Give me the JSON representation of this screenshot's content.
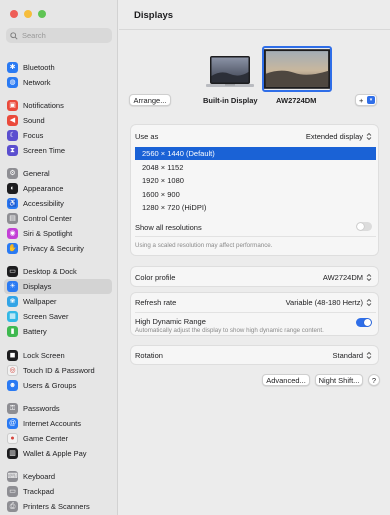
{
  "traffic_lights": {
    "close": "#ee5e57",
    "minimize": "#f6bd3b",
    "zoom": "#5fc454"
  },
  "search": {
    "placeholder": "Search"
  },
  "sidebar": {
    "items": [
      {
        "label": "Bluetooth",
        "icon": "bluetooth-icon",
        "color": "#2a7af3",
        "glyph": "✱"
      },
      {
        "label": "Network",
        "icon": "globe-icon",
        "color": "#2a7af3",
        "glyph": "◍"
      },
      {
        "label": "Notifications",
        "icon": "bell-icon",
        "color": "#ea4a3b",
        "glyph": "▣"
      },
      {
        "label": "Sound",
        "icon": "speaker-icon",
        "color": "#ea4a3b",
        "glyph": "◀"
      },
      {
        "label": "Focus",
        "icon": "moon-icon",
        "color": "#5b4fcf",
        "glyph": "☾"
      },
      {
        "label": "Screen Time",
        "icon": "hourglass-icon",
        "color": "#5b4fcf",
        "glyph": "⧗"
      },
      {
        "label": "General",
        "icon": "gear-icon",
        "color": "#8e8e93",
        "glyph": "⚙"
      },
      {
        "label": "Appearance",
        "icon": "appearance-icon",
        "color": "#1d1d1f",
        "glyph": "◐"
      },
      {
        "label": "Accessibility",
        "icon": "accessibility-icon",
        "color": "#2a7af3",
        "glyph": "♿"
      },
      {
        "label": "Control Center",
        "icon": "control-center-icon",
        "color": "#8e8e93",
        "glyph": "▤"
      },
      {
        "label": "Siri & Spotlight",
        "icon": "siri-icon",
        "color": "#c33fd6",
        "glyph": "◉"
      },
      {
        "label": "Privacy & Security",
        "icon": "hand-icon",
        "color": "#2a7af3",
        "glyph": "✋"
      },
      {
        "label": "Desktop & Dock",
        "icon": "dock-icon",
        "color": "#1d1d1f",
        "glyph": "▭"
      },
      {
        "label": "Displays",
        "icon": "sun-icon",
        "color": "#2a7af3",
        "glyph": "☀"
      },
      {
        "label": "Wallpaper",
        "icon": "wallpaper-icon",
        "color": "#32a4e6",
        "glyph": "❀"
      },
      {
        "label": "Screen Saver",
        "icon": "screen-saver-icon",
        "color": "#32b8e6",
        "glyph": "▦"
      },
      {
        "label": "Battery",
        "icon": "battery-icon",
        "color": "#3fb950",
        "glyph": "▮"
      },
      {
        "label": "Lock Screen",
        "icon": "lock-icon",
        "color": "#1d1d1f",
        "glyph": "◼"
      },
      {
        "label": "Touch ID & Password",
        "icon": "fingerprint-icon",
        "color": "#f2f2f2",
        "glyph": "◎"
      },
      {
        "label": "Users & Groups",
        "icon": "users-icon",
        "color": "#2a7af3",
        "glyph": "☻"
      },
      {
        "label": "Passwords",
        "icon": "key-icon",
        "color": "#8e8e93",
        "glyph": "⚿"
      },
      {
        "label": "Internet Accounts",
        "icon": "at-icon",
        "color": "#2a7af3",
        "glyph": "@"
      },
      {
        "label": "Game Center",
        "icon": "game-center-icon",
        "color": "#f2f2f2",
        "glyph": "●"
      },
      {
        "label": "Wallet & Apple Pay",
        "icon": "wallet-icon",
        "color": "#1d1d1f",
        "glyph": "▥"
      },
      {
        "label": "Keyboard",
        "icon": "keyboard-icon",
        "color": "#8e8e93",
        "glyph": "⌨"
      },
      {
        "label": "Trackpad",
        "icon": "trackpad-icon",
        "color": "#8e8e93",
        "glyph": "▭"
      },
      {
        "label": "Printers & Scanners",
        "icon": "printer-icon",
        "color": "#8e8e93",
        "glyph": "⎙"
      }
    ],
    "active": "Displays"
  },
  "main": {
    "title": "Displays",
    "arrange_label": "Arrange...",
    "builtin_display_label": "Built-in Display",
    "external_display_label": "AW2724DM",
    "add_label": "+",
    "use_as": {
      "label": "Use as",
      "value": "Extended display"
    },
    "resolutions": [
      "2560 × 1440 (Default)",
      "2048 × 1152",
      "1920 × 1080",
      "1600 × 900",
      "1280 × 720 (HiDPI)"
    ],
    "selected_resolution": "2560 × 1440 (Default)",
    "show_all_resolutions": {
      "label": "Show all resolutions",
      "enabled": false
    },
    "scaled_note": "Using a scaled resolution may affect performance.",
    "color_profile": {
      "label": "Color profile",
      "value": "AW2724DM"
    },
    "refresh_rate": {
      "label": "Refresh rate",
      "value": "Variable (48-180 Hertz)"
    },
    "hdr": {
      "label": "High Dynamic Range",
      "description": "Automatically adjust the display to show high dynamic range content.",
      "enabled": true
    },
    "rotation": {
      "label": "Rotation",
      "value": "Standard"
    },
    "advanced_label": "Advanced...",
    "night_shift_label": "Night Shift...",
    "help_label": "?"
  },
  "colors": {
    "accent": "#2f6ee8",
    "selection": "#1a62d6",
    "sidebar_active": "#d3d3d3"
  }
}
